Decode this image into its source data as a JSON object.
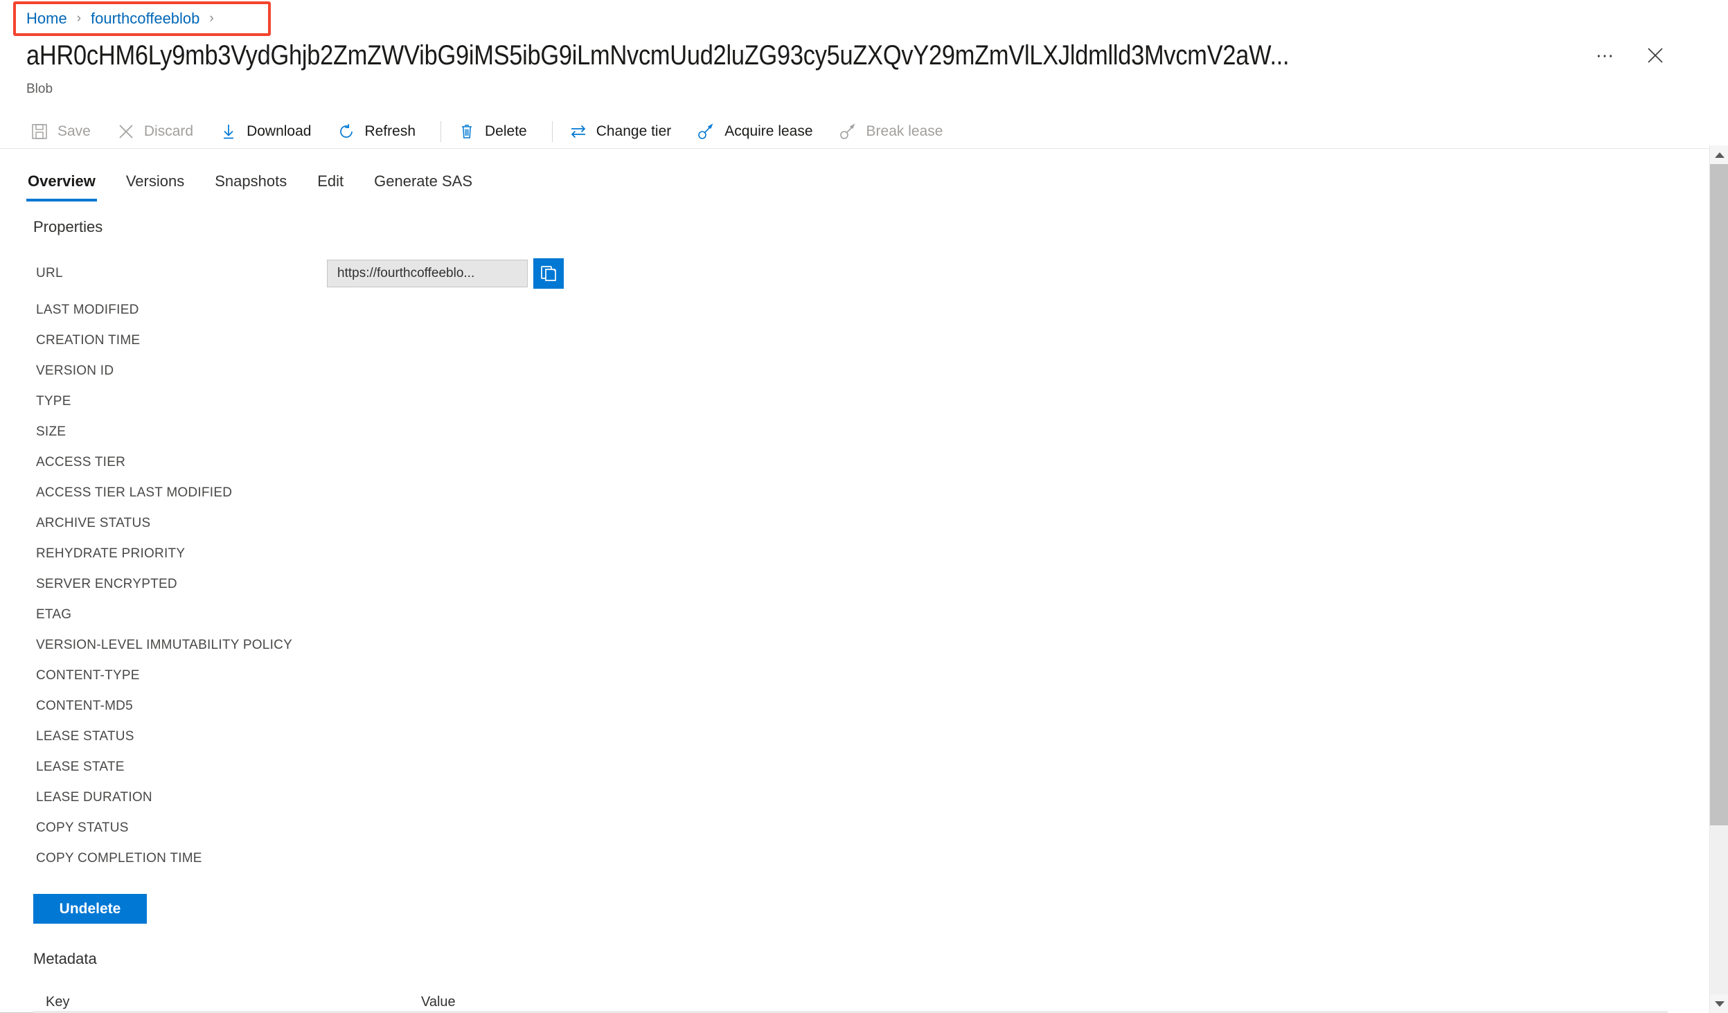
{
  "breadcrumb": {
    "items": [
      {
        "label": "Home"
      },
      {
        "label": "fourthcoffeeblob"
      }
    ],
    "separator": "›",
    "highlight_color": "#f4442e"
  },
  "header": {
    "title": "aHR0cHM6Ly9mb3VydGhjb2ZmZWVibG9iMS5ibG9iLmNvcmUud2luZG93cy5uZXQvY29mZmVlLXJldmlld3MvcmV2aW...",
    "subtitle": "Blob",
    "more_label": "•••",
    "close_label": "✕"
  },
  "toolbar": {
    "items": [
      {
        "label": "Save",
        "icon": "save-icon",
        "disabled": true
      },
      {
        "label": "Discard",
        "icon": "discard-icon",
        "disabled": true
      },
      {
        "label": "Download",
        "icon": "download-icon",
        "disabled": false
      },
      {
        "label": "Refresh",
        "icon": "refresh-icon",
        "disabled": false
      },
      {
        "label": "Delete",
        "icon": "delete-icon",
        "disabled": false
      },
      {
        "label": "Change tier",
        "icon": "change-tier-icon",
        "disabled": false
      },
      {
        "label": "Acquire lease",
        "icon": "acquire-lease-icon",
        "disabled": false
      },
      {
        "label": "Break lease",
        "icon": "break-lease-icon",
        "disabled": true
      }
    ]
  },
  "tabs": [
    {
      "label": "Overview",
      "active": true
    },
    {
      "label": "Versions",
      "active": false
    },
    {
      "label": "Snapshots",
      "active": false
    },
    {
      "label": "Edit",
      "active": false
    },
    {
      "label": "Generate SAS",
      "active": false
    }
  ],
  "properties": {
    "section_title": "Properties",
    "url": {
      "key": "URL",
      "value": "https://fourthcoffeeblo...",
      "copy_tooltip": "Copy to clipboard"
    },
    "rows": [
      {
        "key": "LAST MODIFIED",
        "value": ""
      },
      {
        "key": "CREATION TIME",
        "value": ""
      },
      {
        "key": "VERSION ID",
        "value": ""
      },
      {
        "key": "TYPE",
        "value": ""
      },
      {
        "key": "SIZE",
        "value": ""
      },
      {
        "key": "ACCESS TIER",
        "value": ""
      },
      {
        "key": "ACCESS TIER LAST MODIFIED",
        "value": ""
      },
      {
        "key": "ARCHIVE STATUS",
        "value": ""
      },
      {
        "key": "REHYDRATE PRIORITY",
        "value": ""
      },
      {
        "key": "SERVER ENCRYPTED",
        "value": ""
      },
      {
        "key": "ETAG",
        "value": ""
      },
      {
        "key": "VERSION-LEVEL IMMUTABILITY POLICY",
        "value": ""
      },
      {
        "key": "CONTENT-TYPE",
        "value": ""
      },
      {
        "key": "CONTENT-MD5",
        "value": ""
      },
      {
        "key": "LEASE STATUS",
        "value": ""
      },
      {
        "key": "LEASE STATE",
        "value": ""
      },
      {
        "key": "LEASE DURATION",
        "value": ""
      },
      {
        "key": "COPY STATUS",
        "value": ""
      },
      {
        "key": "COPY COMPLETION TIME",
        "value": ""
      }
    ]
  },
  "undelete": {
    "label": "Undelete"
  },
  "metadata": {
    "section_title": "Metadata",
    "columns": [
      "Key",
      "Value"
    ]
  },
  "colors": {
    "accent": "#0078d4",
    "link": "#0067b8",
    "disabled_text": "#a19f9d",
    "annotation": "#f4442e"
  }
}
